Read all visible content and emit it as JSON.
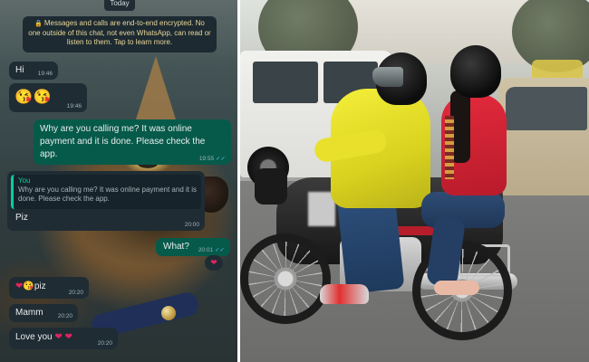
{
  "chat": {
    "date_label": "Today",
    "encryption_notice": "Messages and calls are end-to-end encrypted. No one outside of this chat, not even WhatsApp, can read or listen to them. Tap to learn more.",
    "messages": [
      {
        "direction": "in",
        "text": "Hi",
        "time": "19:46"
      },
      {
        "direction": "in",
        "emoji": "😘😘",
        "time": "19:46"
      },
      {
        "direction": "out",
        "text": "Why are you calling me? It was online payment and it is done. Please check the app.",
        "time": "19:55"
      },
      {
        "direction": "in",
        "quote_author": "You",
        "quote_text": "Why are you calling me? It was online payment and it is done. Please check the app.",
        "text": "Piz",
        "time": "20:00"
      },
      {
        "direction": "out",
        "text": "What?",
        "time": "20:01"
      },
      {
        "direction": "in",
        "hearts": "❤",
        "face": "😘",
        "text": "piz",
        "time": "20:20"
      },
      {
        "direction": "in",
        "text": "Mamm",
        "time": "20:20"
      },
      {
        "direction": "in",
        "text": "Love you",
        "hearts": "❤ ❤",
        "time": "20:20"
      }
    ],
    "reaction": "❤",
    "read_receipt": "✓✓",
    "colors": {
      "incoming_bubble": "#1f2c34",
      "outgoing_bubble": "#065a4a",
      "quote_accent": "#06cf9c",
      "notice_text": "#e9d79a",
      "read_tick": "#53bdeb"
    }
  },
  "icons": {
    "lock": "lock-icon",
    "double_tick": "double-check-icon",
    "reaction": "heart-icon"
  }
}
